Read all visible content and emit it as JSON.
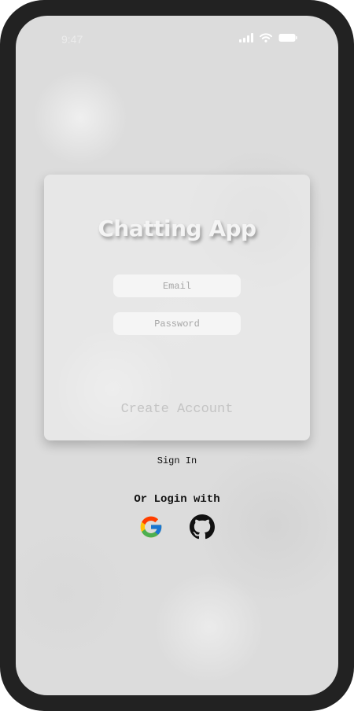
{
  "status_bar": {
    "time": "9:47"
  },
  "login": {
    "title": "Chatting App",
    "email_placeholder": "Email",
    "email_value": "",
    "password_placeholder": "Password",
    "password_value": "",
    "create_account_label": "Create Account",
    "sign_in_label": "Sign In",
    "or_login_label": "Or Login with"
  },
  "social": {
    "providers": [
      {
        "icon": "google-icon"
      },
      {
        "icon": "github-icon"
      }
    ]
  },
  "colors": {
    "frame": "#222222",
    "background": "#dcdcdc",
    "card": "#eeeeee",
    "title": "#f4f4f4",
    "text_dark": "#111111",
    "muted_text": "#c4c4c4"
  }
}
